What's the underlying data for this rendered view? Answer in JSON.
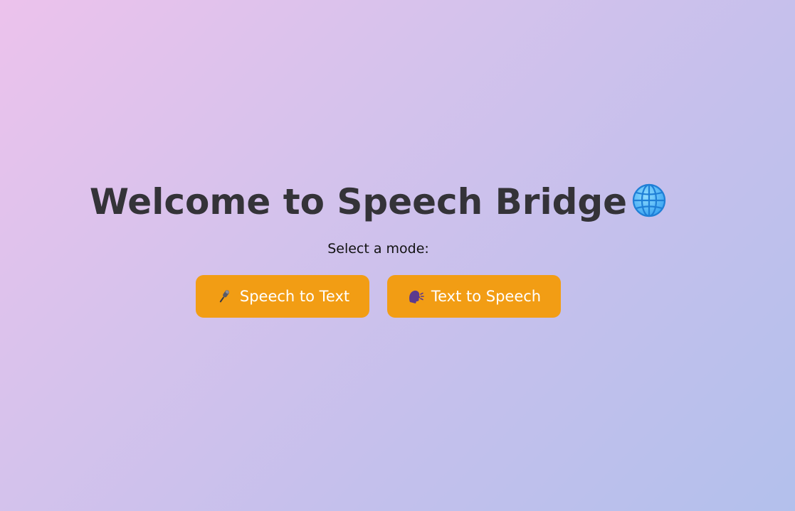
{
  "header": {
    "title": "Welcome to Speech Bridge",
    "title_icon": "globe-icon",
    "subtitle": "Select a mode:"
  },
  "modes": [
    {
      "label": "Speech to Text",
      "icon": "microphone-icon"
    },
    {
      "label": "Text to Speech",
      "icon": "speaking-head-icon"
    }
  ],
  "colors": {
    "button_bg": "#f29d14",
    "button_text": "#ffffff",
    "title_text": "#343338",
    "background_start": "#ecc2ec",
    "background_end": "#b3c0ec"
  }
}
